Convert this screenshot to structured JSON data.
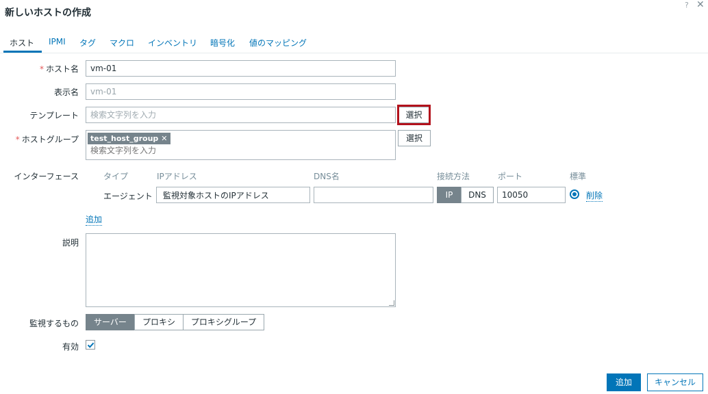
{
  "dialog": {
    "title": "新しいホストの作成",
    "help_glyph": "?",
    "close_glyph": "✕"
  },
  "tabs": [
    {
      "label": "ホスト",
      "active": true
    },
    {
      "label": "IPMI"
    },
    {
      "label": "タグ"
    },
    {
      "label": "マクロ"
    },
    {
      "label": "インベントリ"
    },
    {
      "label": "暗号化"
    },
    {
      "label": "値のマッピング"
    }
  ],
  "form": {
    "host_name": {
      "label": "ホスト名",
      "required_mark": "*",
      "value": "vm-01"
    },
    "display_name": {
      "label": "表示名",
      "value": "vm-01"
    },
    "templates": {
      "label": "テンプレート",
      "placeholder": "検索文字列を入力",
      "select_label": "選択"
    },
    "host_groups": {
      "label": "ホストグループ",
      "required_mark": "*",
      "chip": "test_host_group",
      "chip_remove": "✕",
      "placeholder": "検索文字列を入力",
      "select_label": "選択"
    },
    "interfaces": {
      "label": "インターフェース",
      "headers": {
        "type": "タイプ",
        "ip": "IPアドレス",
        "dns": "DNS名",
        "connect": "接続方法",
        "port": "ポート",
        "default": "標準"
      },
      "row": {
        "type": "エージェント",
        "ip": "監視対象ホストのIPアドレス",
        "dns": "",
        "connect_ip": "IP",
        "connect_dns": "DNS",
        "connect_selected": "IP",
        "port": "10050",
        "remove": "削除"
      },
      "add_link": "追加"
    },
    "description": {
      "label": "説明",
      "value": ""
    },
    "monitored_by": {
      "label": "監視するもの",
      "options": [
        "サーバー",
        "プロキシ",
        "プロキシグループ"
      ],
      "selected": "サーバー"
    },
    "enabled": {
      "label": "有効",
      "checked": true
    }
  },
  "footer": {
    "add": "追加",
    "cancel": "キャンセル"
  },
  "colors": {
    "accent": "#0275b8",
    "highlight": "#b3121c",
    "required": "#e45959",
    "segment_on": "#76848c"
  }
}
